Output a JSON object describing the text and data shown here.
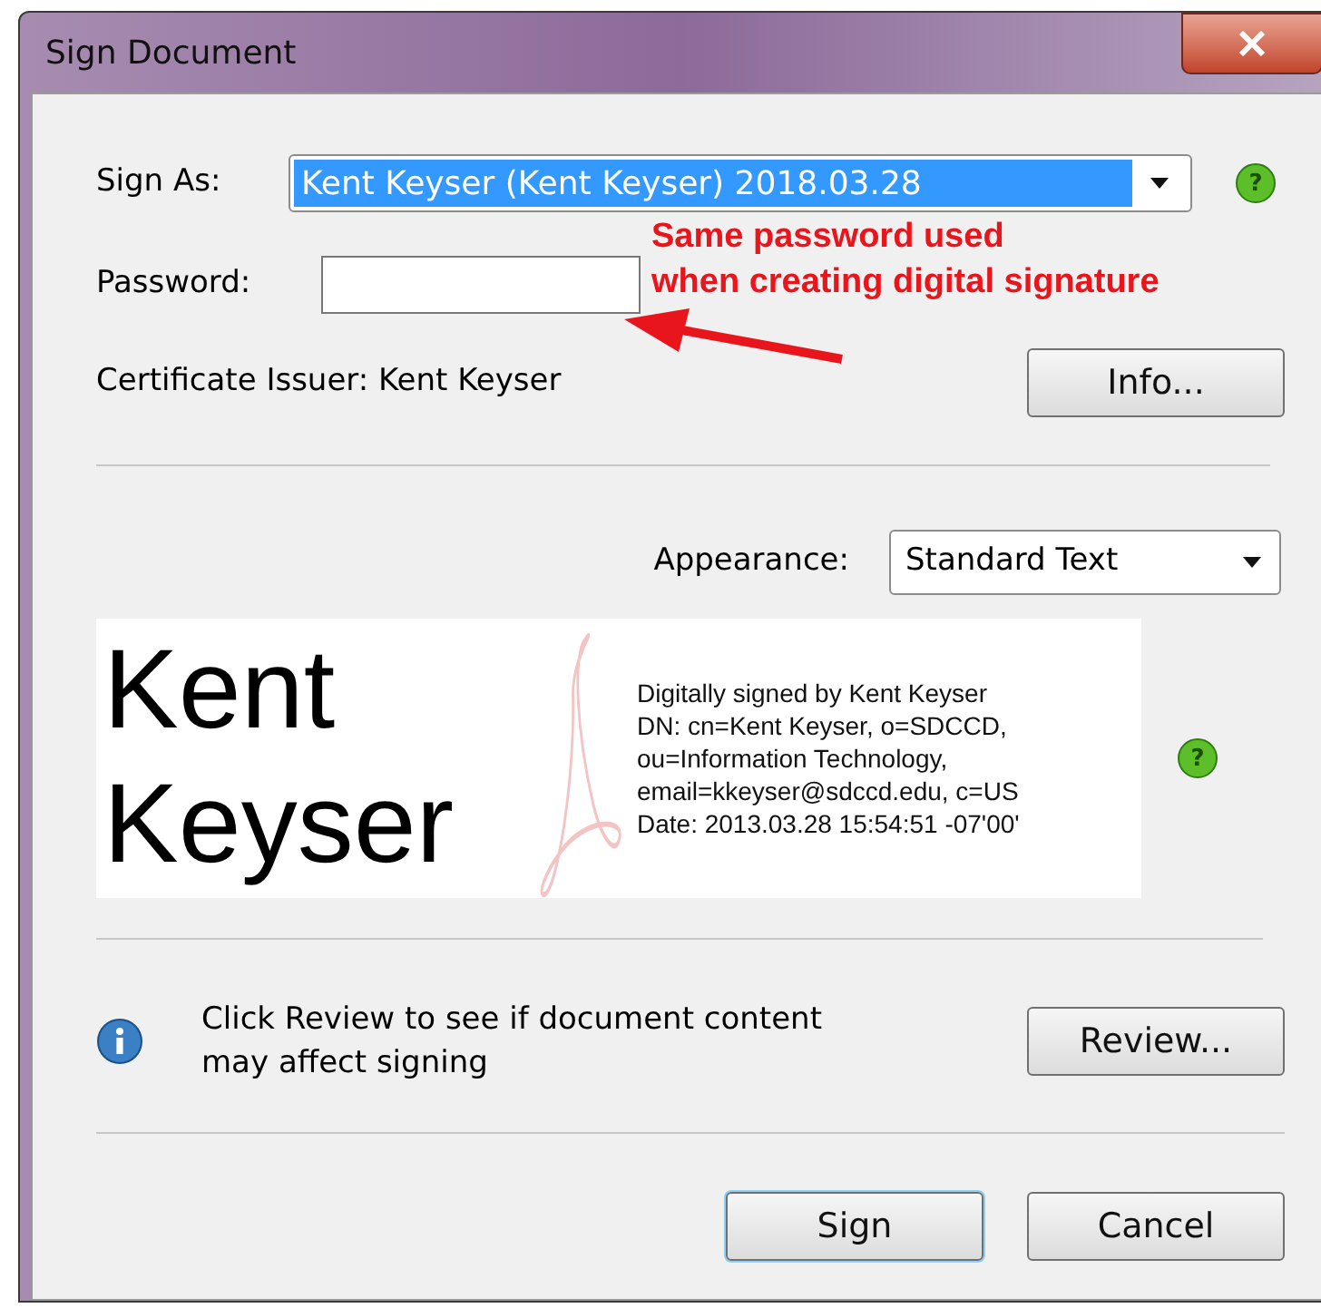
{
  "window": {
    "title": "Sign Document"
  },
  "sign_as": {
    "label": "Sign As:",
    "value": "Kent Keyser (Kent Keyser) 2018.03.28",
    "selected": true,
    "help": "?"
  },
  "password": {
    "label": "Password:"
  },
  "annotation": {
    "text": "Same password used\nwhen creating digital signature"
  },
  "certificate": {
    "text": "Certificate Issuer: Kent Keyser",
    "button": "Info..."
  },
  "appearance": {
    "label": "Appearance:",
    "value": "Standard Text"
  },
  "signature_preview": {
    "help": "?",
    "name": "Kent\nKeyser",
    "details": "Digitally signed by Kent Keyser\nDN: cn=Kent Keyser, o=SDCCD,\nou=Information Technology,\nemail=kkeyser@sdccd.edu, c=US\nDate: 2013.03.28 15:54:51 -07'00'"
  },
  "review": {
    "text": "Click Review to see if document content\nmay affect signing",
    "button": "Review..."
  },
  "buttons": [
    {
      "label": "Sign",
      "default": true
    },
    {
      "label": "Cancel",
      "default": false
    }
  ]
}
